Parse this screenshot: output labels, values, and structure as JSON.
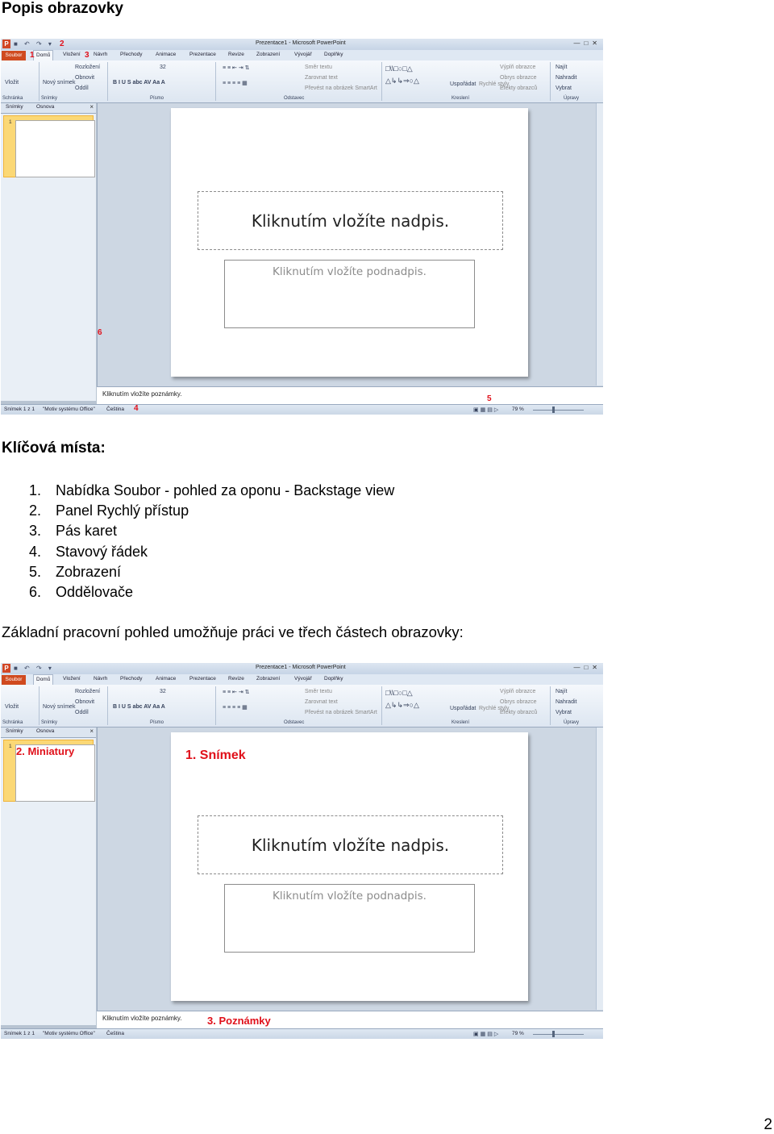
{
  "heading": "Popis obrazovky",
  "key_points_heading": "Klíčová místa:",
  "key_points": [
    {
      "num": "1.",
      "text": "Nabídka Soubor - pohled za oponu - Backstage view"
    },
    {
      "num": "2.",
      "text": "Panel Rychlý přístup"
    },
    {
      "num": "3.",
      "text": "Pás karet"
    },
    {
      "num": "4.",
      "text": "Stavový řádek"
    },
    {
      "num": "5.",
      "text": "Zobrazení"
    },
    {
      "num": "6.",
      "text": "Oddělovače"
    }
  ],
  "paragraph": "Základní pracovní pohled umožňuje práci ve třech částech obrazovky:",
  "page_number": "2",
  "powerpoint": {
    "window_title": "Prezentace1 - Microsoft PowerPoint",
    "tabs": {
      "file": "Soubor",
      "home": "Domů",
      "insert": "Vložení",
      "design": "Návrh",
      "transitions": "Přechody",
      "animations": "Animace",
      "slideshow": "Prezentace",
      "review": "Revize",
      "view": "Zobrazení",
      "developer": "Vývojář",
      "addins": "Doplňky"
    },
    "ribbon": {
      "paste": "Vložit",
      "clipboard": "Schránka",
      "new_slide": "Nový snímek",
      "layout": "Rozložení",
      "reset": "Obnovit",
      "section": "Oddíl",
      "slides": "Snímky",
      "font_size": "32",
      "font": "Písmo",
      "text_direction": "Směr textu",
      "align_text": "Zarovnat text",
      "smartart": "Převést na obrázek SmartArt",
      "paragraph": "Odstavec",
      "arrange": "Uspořádat",
      "quick_styles": "Rychlé styly",
      "shape_fill": "Výplň obrazce",
      "shape_outline": "Obrys obrazce",
      "shape_effects": "Efekty obrazců",
      "drawing": "Kreslení",
      "find": "Najít",
      "replace": "Nahradit",
      "select": "Vybrat",
      "editing": "Úpravy"
    },
    "pane_tabs": {
      "slides": "Snímky",
      "outline": "Osnova"
    },
    "thumb_number": "1",
    "slide_title_placeholder": "Kliknutím vložíte nadpis.",
    "slide_subtitle_placeholder": "Kliknutím vložíte podnadpis.",
    "notes_placeholder": "Kliknutím vložíte poznámky.",
    "status": {
      "slide": "Snímek 1 z 1",
      "theme": "\"Motiv systému Office\"",
      "language": "Čeština",
      "zoom": "79 %"
    }
  },
  "screenshot1_markers": [
    "1",
    "2",
    "3",
    "4",
    "5",
    "6"
  ],
  "screenshot2_labels": {
    "slide": "1. Snímek",
    "thumbnails": "2. Miniatury",
    "notes": "3. Poznámky"
  },
  "colors": {
    "marker": "#e0101a",
    "file_tab": "#d04a1f",
    "thumb_highlight": "#fbd876"
  }
}
